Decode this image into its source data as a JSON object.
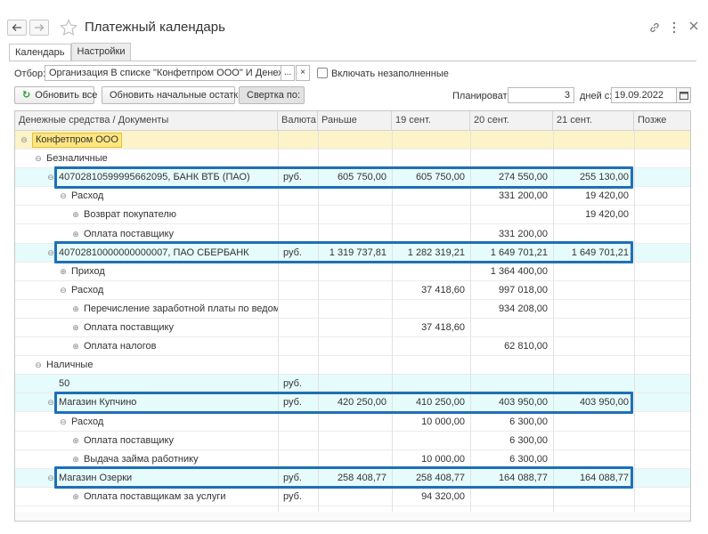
{
  "window": {
    "title": "Платежный календарь",
    "icons": [
      "back-arrow-icon",
      "forward-arrow-icon",
      "star-icon",
      "link-icon",
      "more-icon",
      "close-icon"
    ]
  },
  "tabs": [
    {
      "label": "Календарь",
      "active": true
    },
    {
      "label": "Настройки",
      "active": false
    }
  ],
  "filter": {
    "label": "Отбор:",
    "value": "Организация В списке \"Конфетпром ООО\" И Денежные сре",
    "more": "...",
    "clear": "×",
    "include_empty_label": "Включать незаполненные",
    "include_empty_checked": false
  },
  "toolbar": {
    "refresh_all": "Обновить все",
    "refresh_balances": "Обновить начальные остатки",
    "collapse": "Свертка по:",
    "plan_label": "Планировать:",
    "plan_value": "3",
    "days_from_label": "дней с:",
    "date_value": "19.09.2022"
  },
  "table": {
    "columns": [
      "Денежные средства / Документы",
      "Валюта",
      "Раньше",
      "19 сент.",
      "20 сент.",
      "21 сент.",
      "Позже"
    ],
    "rows": [
      {
        "name": "Конфетпром ООО",
        "toggle": "⊖",
        "currency": "",
        "earlier": "",
        "d19": "",
        "d20": "",
        "d21": "",
        "later": ""
      },
      {
        "name": "Безналичные",
        "toggle": "⊖",
        "currency": "",
        "earlier": "",
        "d19": "",
        "d20": "",
        "d21": "",
        "later": ""
      },
      {
        "name": "40702810599995662095, БАНК ВТБ (ПАО)",
        "toggle": "⊖",
        "currency": "руб.",
        "earlier": "605 750,00",
        "d19": "605 750,00",
        "d20": "274 550,00",
        "d21": "255 130,00",
        "later": ""
      },
      {
        "name": "Расход",
        "toggle": "⊖",
        "currency": "",
        "earlier": "",
        "d19": "",
        "d20": "331 200,00",
        "d21": "19 420,00",
        "later": ""
      },
      {
        "name": "Возврат покупателю",
        "toggle": "⊕",
        "currency": "",
        "earlier": "",
        "d19": "",
        "d20": "",
        "d21": "19 420,00",
        "later": ""
      },
      {
        "name": "Оплата поставщику",
        "toggle": "⊕",
        "currency": "",
        "earlier": "",
        "d19": "",
        "d20": "331 200,00",
        "d21": "",
        "later": ""
      },
      {
        "name": "40702810000000000007, ПАО СБЕРБАНК",
        "toggle": "⊖",
        "currency": "руб.",
        "earlier": "1 319 737,81",
        "d19": "1 282 319,21",
        "d20": "1 649 701,21",
        "d21": "1 649 701,21",
        "later": ""
      },
      {
        "name": "Приход",
        "toggle": "⊕",
        "currency": "",
        "earlier": "",
        "d19": "",
        "d20": "1 364 400,00",
        "d21": "",
        "later": ""
      },
      {
        "name": "Расход",
        "toggle": "⊖",
        "currency": "",
        "earlier": "",
        "d19": "37 418,60",
        "d20": "997 018,00",
        "d21": "",
        "later": ""
      },
      {
        "name": "Перечисление заработной платы по ведомостям",
        "toggle": "⊕",
        "currency": "",
        "earlier": "",
        "d19": "",
        "d20": "934 208,00",
        "d21": "",
        "later": ""
      },
      {
        "name": "Оплата поставщику",
        "toggle": "⊕",
        "currency": "",
        "earlier": "",
        "d19": "37 418,60",
        "d20": "",
        "d21": "",
        "later": ""
      },
      {
        "name": "Оплата налогов",
        "toggle": "⊕",
        "currency": "",
        "earlier": "",
        "d19": "",
        "d20": "62 810,00",
        "d21": "",
        "later": ""
      },
      {
        "name": "Наличные",
        "toggle": "⊖",
        "currency": "",
        "earlier": "",
        "d19": "",
        "d20": "",
        "d21": "",
        "later": ""
      },
      {
        "name": "50",
        "toggle": "",
        "currency": "руб.",
        "earlier": "",
        "d19": "",
        "d20": "",
        "d21": "",
        "later": ""
      },
      {
        "name": "Магазин Купчино",
        "toggle": "⊖",
        "currency": "руб.",
        "earlier": "420 250,00",
        "d19": "410 250,00",
        "d20": "403 950,00",
        "d21": "403 950,00",
        "later": ""
      },
      {
        "name": "Расход",
        "toggle": "⊖",
        "currency": "",
        "earlier": "",
        "d19": "10 000,00",
        "d20": "6 300,00",
        "d21": "",
        "later": ""
      },
      {
        "name": "Оплата поставщику",
        "toggle": "⊕",
        "currency": "",
        "earlier": "",
        "d19": "",
        "d20": "6 300,00",
        "d21": "",
        "later": ""
      },
      {
        "name": "Выдача займа работнику",
        "toggle": "⊕",
        "currency": "",
        "earlier": "",
        "d19": "10 000,00",
        "d20": "6 300,00",
        "d21": "",
        "later": ""
      },
      {
        "name": "Магазин Озерки",
        "toggle": "⊖",
        "currency": "руб.",
        "earlier": "258 408,77",
        "d19": "258 408,77",
        "d20": "164 088,77",
        "d21": "164 088,77",
        "later": ""
      },
      {
        "name": "Оплата поставщикам за услуги",
        "toggle": "⊕",
        "currency": "руб.",
        "earlier": "",
        "d19": "94 320,00",
        "d20": "",
        "d21": "",
        "later": ""
      }
    ]
  },
  "colors": {
    "highlight_frame": "#1f6fb5",
    "org_row": "#fdf3c8",
    "org_label": "#ffe680",
    "account_row": "#e6fbfb"
  }
}
